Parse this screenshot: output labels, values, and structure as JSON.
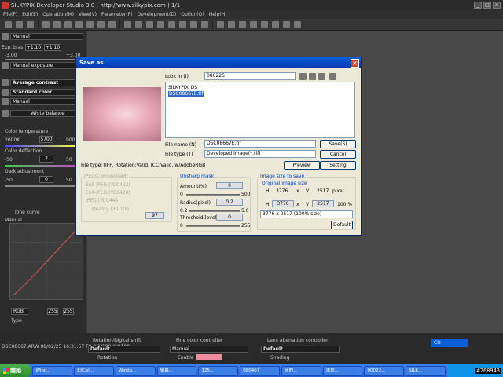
{
  "app": {
    "title": "SILKYPIX Developer Studio 3.0 ( http://www.silkypix.com )   1/1"
  },
  "menu": [
    "File(F)",
    "Edit(E)",
    "Operation(M)",
    "View(V)",
    "Parameter(P)",
    "Development(D)",
    "Option(O)",
    "Help(H)"
  ],
  "left": {
    "taste": "Manual",
    "exp_label": "Exp. bias",
    "exp_min": "-3.00",
    "exp_val": "+1.10",
    "exp_max": "+3.00",
    "exp_val2": "+1.10",
    "mode1": "Manual exposure",
    "contrast": "Average contrast",
    "sharp": "Standard color",
    "manual2": "Manual",
    "wb": "White balance",
    "ct_label": "Color temperature",
    "ct_min": "2000K",
    "ct_val": "5700",
    "ct_max": "9000",
    "cd_label": "Color deflection",
    "cd_min": "-50",
    "cd_val": "7",
    "cd_max": "50",
    "da_label": "Dark adjustment",
    "da_min": "-50",
    "da_val": "0",
    "da_max": "50",
    "tc_label": "Tone curve",
    "tc_mode": "Manual",
    "rgb": "RGB",
    "rgb_a": "255",
    "rgb_b": "255",
    "type_label": "Type"
  },
  "dialog": {
    "title": "Save as",
    "lookin_label": "Look in (I)",
    "lookin_val": "080225",
    "files": [
      "SILKYPIX_DS",
      "DSC08667E.tif"
    ],
    "filename_label": "File name (N)",
    "filename_val": "DSC08667E.tif",
    "filetype_label": "File type (T)",
    "filetype_val": "Developed image(*.tif)",
    "save_btn": "Save(S)",
    "cancel_btn": "Cancel",
    "preview_btn": "Preview",
    "setting_btn": "Setting",
    "info": "File type:TIFF, Rotation:Valid, ICC:Valid, w/AdobeRGB",
    "jpeg_group": "JPEG(Compressed)",
    "jpeg_opts": [
      "Exif-JPEG (YCC422)",
      "Exif-JPEG (YCC420)",
      "JPEG (YCC444)"
    ],
    "quality": "Quality (30-100)",
    "quality_val": "97",
    "unsharp_group": "Unsharp mask",
    "amount_label": "Amount(%)",
    "amount_val": "0",
    "amount_min": "0",
    "amount_max": "500",
    "radius_label": "Radius(pixel)",
    "radius_val": "0.2",
    "radius_min": "0.2",
    "radius_max": "5.0",
    "thresh_label": "Threshold(level)",
    "thresh_val": "0",
    "thresh_min": "0",
    "thresh_max": "255",
    "size_group": "Image size to save",
    "orig_label": "Original image size",
    "h": "H",
    "v": "V",
    "x": "x",
    "orig_h": "3776",
    "orig_v": "2517",
    "pixel": "pixel",
    "new_h": "3776",
    "new_v": "2517",
    "percent": "100 %",
    "size_select": "3776 x 2517 (100% size)",
    "default_btn": "Default"
  },
  "bottom": {
    "p1_title": "Rotation/Digital shift",
    "p1_sel": "Default",
    "p1_chk": "Rotation",
    "p2_title": "Fine color controller",
    "p2_sel": "Manual",
    "p2_chk": "Enable",
    "p3_title": "Lens aberration controller",
    "p3_sel": "Default",
    "p3_chk": "Shading",
    "status": "DSC08667.ARW 08/02/25 16:31:57 F8.0 1/100 ISO100",
    "lang": "CH"
  },
  "taskbar": {
    "start": "開始",
    "tasks": [
      "Wind...",
      "EXCel...",
      "Windo...",
      "螢幕...",
      "125...",
      "080407",
      "商的...",
      "未命...",
      "00022...",
      "SILK..."
    ],
    "tag": "#268943"
  }
}
